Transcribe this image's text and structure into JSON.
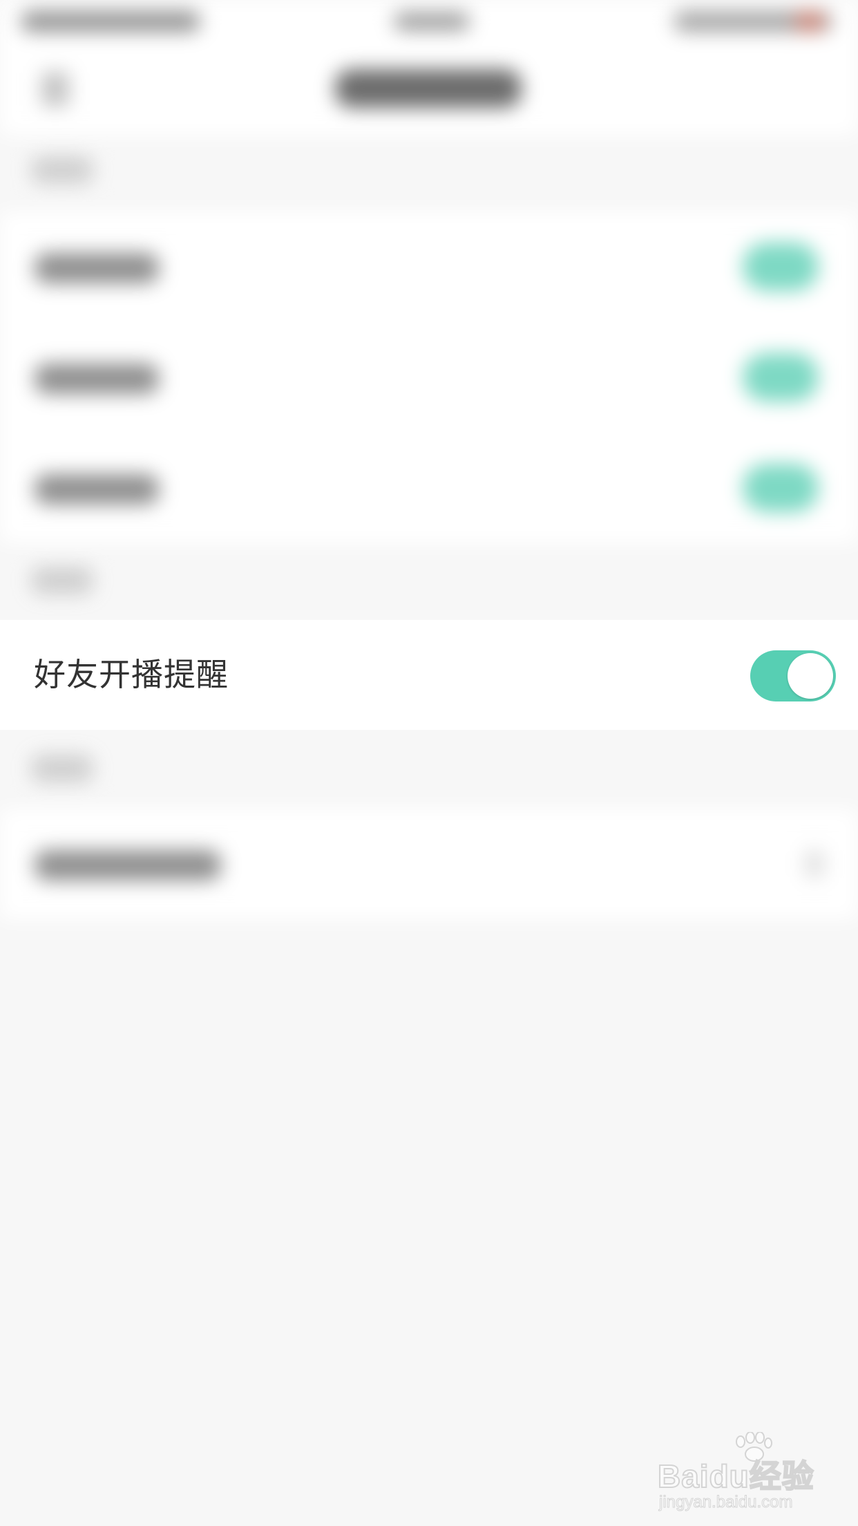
{
  "notification_settings": {
    "live_reminder": {
      "label": "好友开播提醒",
      "enabled": true,
      "toggle_color": "#57cfb3"
    }
  },
  "watermark": {
    "main": "Baidu经验",
    "sub": "jingyan.baidu.com"
  },
  "colors": {
    "background": "#f7f7f7",
    "row_background": "#ffffff",
    "label_text": "#333333"
  }
}
